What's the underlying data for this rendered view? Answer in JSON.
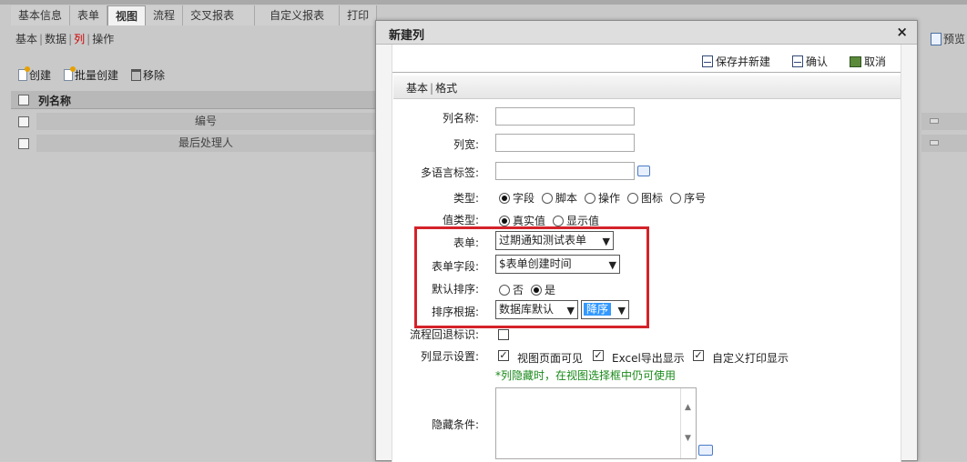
{
  "main_tabs": [
    "基本信息",
    "表单",
    "视图",
    "流程",
    "交叉报表",
    "自定义报表",
    "打印"
  ],
  "main_active_index": 2,
  "sub_tabs": [
    "基本",
    "数据",
    "列",
    "操作"
  ],
  "toolbar": {
    "create": "创建",
    "batch_create": "批量创建",
    "remove": "移除"
  },
  "grid": {
    "header": "列名称",
    "rows": [
      "编号",
      "最后处理人"
    ]
  },
  "preview_label": "预览",
  "dialog": {
    "title": "新建列",
    "close": "×",
    "actions": {
      "save_new": "保存并新建",
      "confirm": "确认",
      "cancel": "取消"
    },
    "format_tabs": {
      "basic": "基本",
      "format": "格式"
    },
    "fields": {
      "col_name": "列名称:",
      "col_width": "列宽:",
      "multilang": "多语言标签:",
      "type": "类型:",
      "type_options": [
        "字段",
        "脚本",
        "操作",
        "图标",
        "序号"
      ],
      "type_selected_index": 0,
      "value_type": "值类型:",
      "value_type_options": [
        "真实值",
        "显示值"
      ],
      "value_type_selected_index": 0,
      "form": "表单:",
      "form_value": "过期通知测试表单",
      "form_field": "表单字段:",
      "form_field_value": "$表单创建时间",
      "default_sort": "默认排序:",
      "default_sort_options": [
        "否",
        "是"
      ],
      "default_sort_selected_index": 1,
      "sort_by": "排序根据:",
      "sort_by_value": "数据库默认",
      "sort_order_value": "降序",
      "flow_back": "流程回退标识:",
      "display_settings": "列显示设置:",
      "display_options": [
        "视图页面可见",
        "Excel导出显示",
        "自定义打印显示"
      ],
      "hint": "*列隐藏时，在视图选择框中仍可使用",
      "hide_condition": "隐藏条件:"
    }
  },
  "colors": {
    "highlight_border": "#d4222a",
    "hint_green": "#1a8a1a",
    "select_highlight": "#3399ff"
  }
}
